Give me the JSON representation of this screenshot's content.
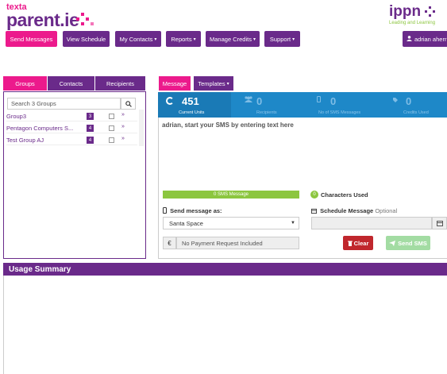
{
  "brand": {
    "top": "texta",
    "main": "parent.ie"
  },
  "partner": {
    "name": "ippn",
    "tagline": "Leading and Learning"
  },
  "nav": [
    {
      "label": "Send Messages",
      "caret": ""
    },
    {
      "label": "View Schedule",
      "caret": ""
    },
    {
      "label": "My Contacts",
      "caret": "▾"
    },
    {
      "label": "Reports",
      "caret": "▾"
    },
    {
      "label": "Manage Credits",
      "caret": "▾"
    },
    {
      "label": "Support",
      "caret": "▾"
    }
  ],
  "user": {
    "label": "adrian aherr",
    "icon": "user-icon"
  },
  "left_tabs": [
    "Groups",
    "Contacts",
    "Recipients"
  ],
  "search": {
    "placeholder": "Search 3 Groups"
  },
  "groups": [
    {
      "name": "Group3",
      "count": "3"
    },
    {
      "name": "Pentagon Computers S...",
      "count": "4"
    },
    {
      "name": "Test Group AJ",
      "count": "4"
    }
  ],
  "right_tabs": {
    "message": "Message",
    "templates": "Templates"
  },
  "stats": [
    {
      "value": "451",
      "label": "Current Units"
    },
    {
      "value": "0",
      "label": "Recipients"
    },
    {
      "value": "0",
      "label": "No of SMS Messages"
    },
    {
      "value": "0",
      "label": "Credits Used"
    }
  ],
  "message": {
    "placeholder": "adrian, start your SMS by entering text here"
  },
  "sms_progress": {
    "label": "0 SMS Message",
    "fraction": 1.0
  },
  "chars": {
    "count": "0",
    "label": "Characters Used"
  },
  "send_as": {
    "label": "Send message as:",
    "value": "Santa Space"
  },
  "schedule": {
    "label": "Schedule Message",
    "optional": "Optional"
  },
  "payment": {
    "currency": "€",
    "value": "No Payment Request Included"
  },
  "buttons": {
    "clear": "Clear",
    "send": "Send SMS"
  },
  "usage": {
    "title": "Usage Summary"
  },
  "colors": {
    "purple": "#6a2a8a",
    "pink": "#ec1a8c",
    "blue": "#1e88c8",
    "green": "#8cc63f",
    "red": "#c0272d"
  }
}
